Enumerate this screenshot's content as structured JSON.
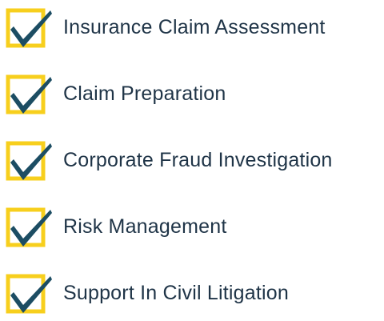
{
  "colors": {
    "box_border": "#f7cf1d",
    "check": "#1c4d63",
    "text": "#1f3447"
  },
  "icon": "checked-box-icon",
  "items": [
    {
      "label": "Insurance Claim Assessment"
    },
    {
      "label": "Claim Preparation"
    },
    {
      "label": "Corporate Fraud Investigation"
    },
    {
      "label": "Risk Management"
    },
    {
      "label": "Support In Civil Litigation"
    }
  ]
}
